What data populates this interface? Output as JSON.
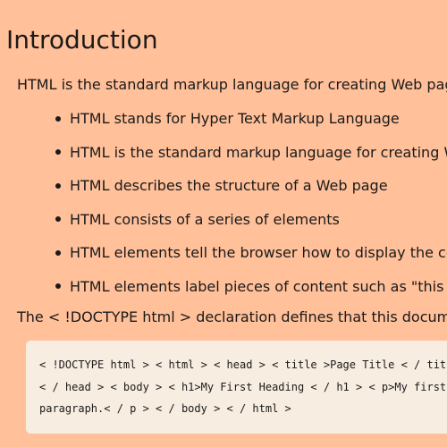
{
  "heading": "Introduction",
  "intro": "HTML is the standard markup language for creating Web pages.",
  "bullets": [
    "HTML stands for Hyper Text Markup Language",
    "HTML is the standard markup language for creating Web pag",
    "HTML describes the structure of a Web page",
    "HTML consists of a series of elements",
    "HTML elements tell the browser how to display the content",
    "HTML elements label pieces of content such as \"this is a hea"
  ],
  "declaration": "The < !DOCTYPE html > declaration defines that this document is an H",
  "code_lines": [
    "< !DOCTYPE html > < html > < head > < title >Page Title < / title >",
    "< / head > < body > < h1>My First Heading < / h1 > < p>My first",
    "paragraph.< / p > < / body > < / html >"
  ]
}
